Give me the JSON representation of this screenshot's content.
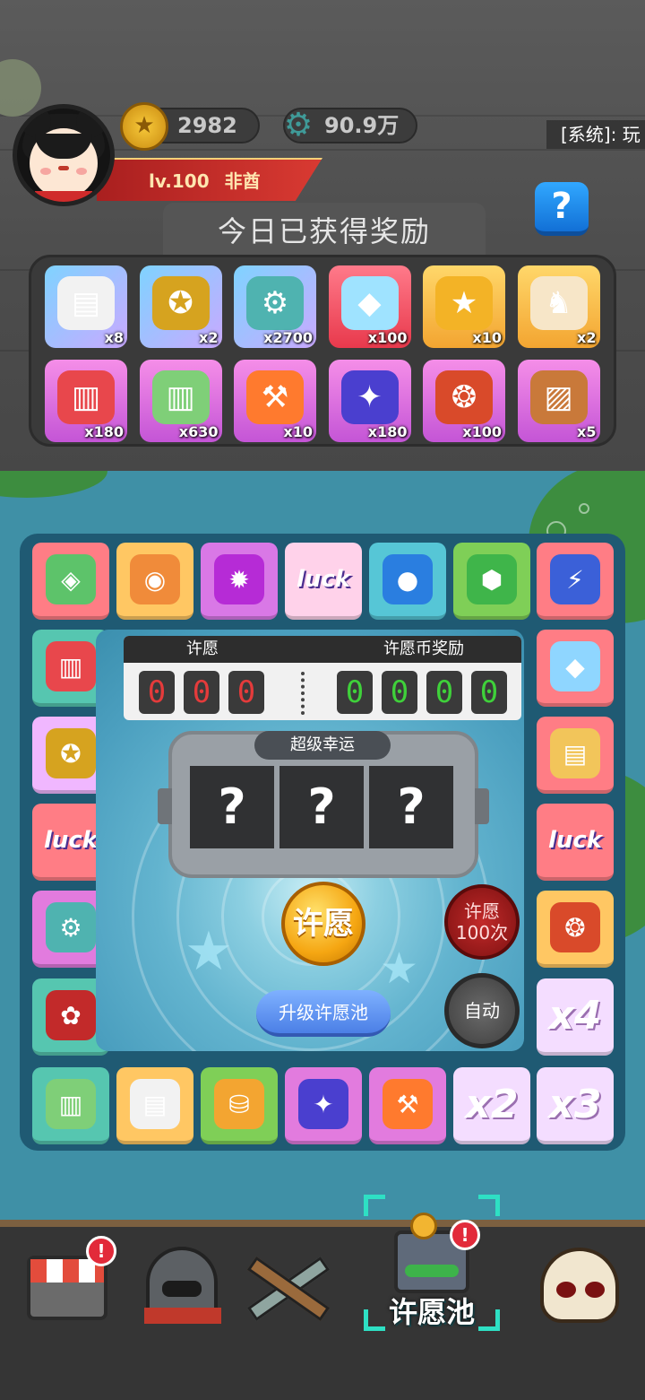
{
  "header": {
    "gold": "2982",
    "gems": "90.9万",
    "system_msg": "[系统]: 玩",
    "level": "lv.100",
    "name": "非酋",
    "help_label": "?"
  },
  "rewards": {
    "title": "今日已获得奖励",
    "items": [
      {
        "icon": "ticket-icon",
        "count": "x8"
      },
      {
        "icon": "medal-icon",
        "count": "x2"
      },
      {
        "icon": "gears-icon",
        "count": "x2700"
      },
      {
        "icon": "diamond-pile-icon",
        "count": "x100"
      },
      {
        "icon": "gold-coin-icon",
        "count": "x10"
      },
      {
        "icon": "rabbit-statue-icon",
        "count": "x2"
      },
      {
        "icon": "red-scroll-icon",
        "count": "x180"
      },
      {
        "icon": "green-scroll-icon",
        "count": "x630"
      },
      {
        "icon": "hammer-card-icon",
        "count": "x10"
      },
      {
        "icon": "purple-orb-icon",
        "count": "x180"
      },
      {
        "icon": "power-food-icon",
        "count": "x100"
      },
      {
        "icon": "tiger-painting-icon",
        "count": "x5"
      }
    ]
  },
  "board": {
    "cells": [
      {
        "icon": "jade-sack-icon"
      },
      {
        "icon": "swirl-tile-icon"
      },
      {
        "icon": "purple-swirl-orb-icon"
      },
      {
        "icon": "luck-firework-icon",
        "text": "luck"
      },
      {
        "icon": "blue-gems-icon"
      },
      {
        "icon": "green-gem-icon"
      },
      {
        "icon": "lightning-bell-icon"
      },
      {
        "icon": "diamond-pile-icon"
      },
      {
        "icon": "lucky-tickets-icon"
      },
      {
        "icon": "luck-firework-icon",
        "text": "luck"
      },
      {
        "icon": "power-food-icon"
      },
      {
        "text": "x4"
      },
      {
        "text": "x3"
      },
      {
        "text": "x2"
      },
      {
        "icon": "hammer-card-icon"
      },
      {
        "icon": "purple-orb-icon"
      },
      {
        "icon": "coin-stacks-icon"
      },
      {
        "icon": "ticket-icon"
      },
      {
        "icon": "green-scroll-icon"
      },
      {
        "icon": "lucky-bag-icon"
      },
      {
        "icon": "gears-icon"
      },
      {
        "icon": "luck-firework-icon",
        "text": "luck"
      },
      {
        "icon": "medal-icon"
      },
      {
        "icon": "red-scroll-icon"
      }
    ],
    "score": {
      "wish_label": "许愿",
      "reward_label": "许愿币奖励",
      "wish_digits": [
        "0",
        "0",
        "0"
      ],
      "reward_digits": [
        "0",
        "0",
        "0",
        "0"
      ]
    },
    "slot": {
      "title": "超级幸运",
      "reels": [
        "?",
        "?",
        "?"
      ]
    },
    "wish_button": "许愿",
    "wish100_line1": "许愿",
    "wish100_line2": "100次",
    "upgrade_button": "升级许愿池",
    "auto_button": "自动"
  },
  "nav": {
    "selected_label": "许愿池",
    "badge": "!"
  },
  "colors": {
    "water": "#3f90a6",
    "board_frame": "#1f5a73",
    "accent_gold": "#f5a612",
    "accent_red": "#c22a2a"
  }
}
